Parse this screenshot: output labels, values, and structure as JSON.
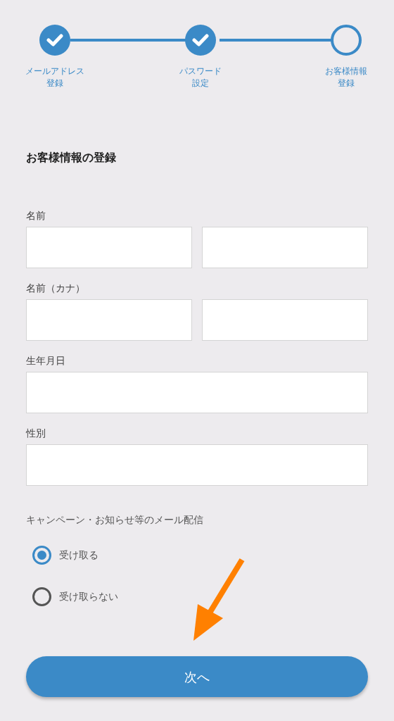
{
  "steps": [
    {
      "label_lines": [
        "メールアドレス",
        "登録"
      ],
      "completed": true
    },
    {
      "label_lines": [
        "パスワード",
        "設定"
      ],
      "completed": true
    },
    {
      "label_lines": [
        "お客様情報",
        "登録"
      ],
      "completed": false
    }
  ],
  "heading": "お客様情報の登録",
  "fields": [
    {
      "label": "名前",
      "kind": "split"
    },
    {
      "label": "名前（カナ）",
      "kind": "split"
    },
    {
      "label": "生年月日",
      "kind": "single"
    },
    {
      "label": "性別",
      "kind": "single"
    }
  ],
  "newsletter": {
    "label": "キャンペーン・お知らせ等のメール配信",
    "options": [
      {
        "label": "受け取る",
        "selected": true
      },
      {
        "label": "受け取らない",
        "selected": false
      }
    ]
  },
  "next_button": "次へ"
}
